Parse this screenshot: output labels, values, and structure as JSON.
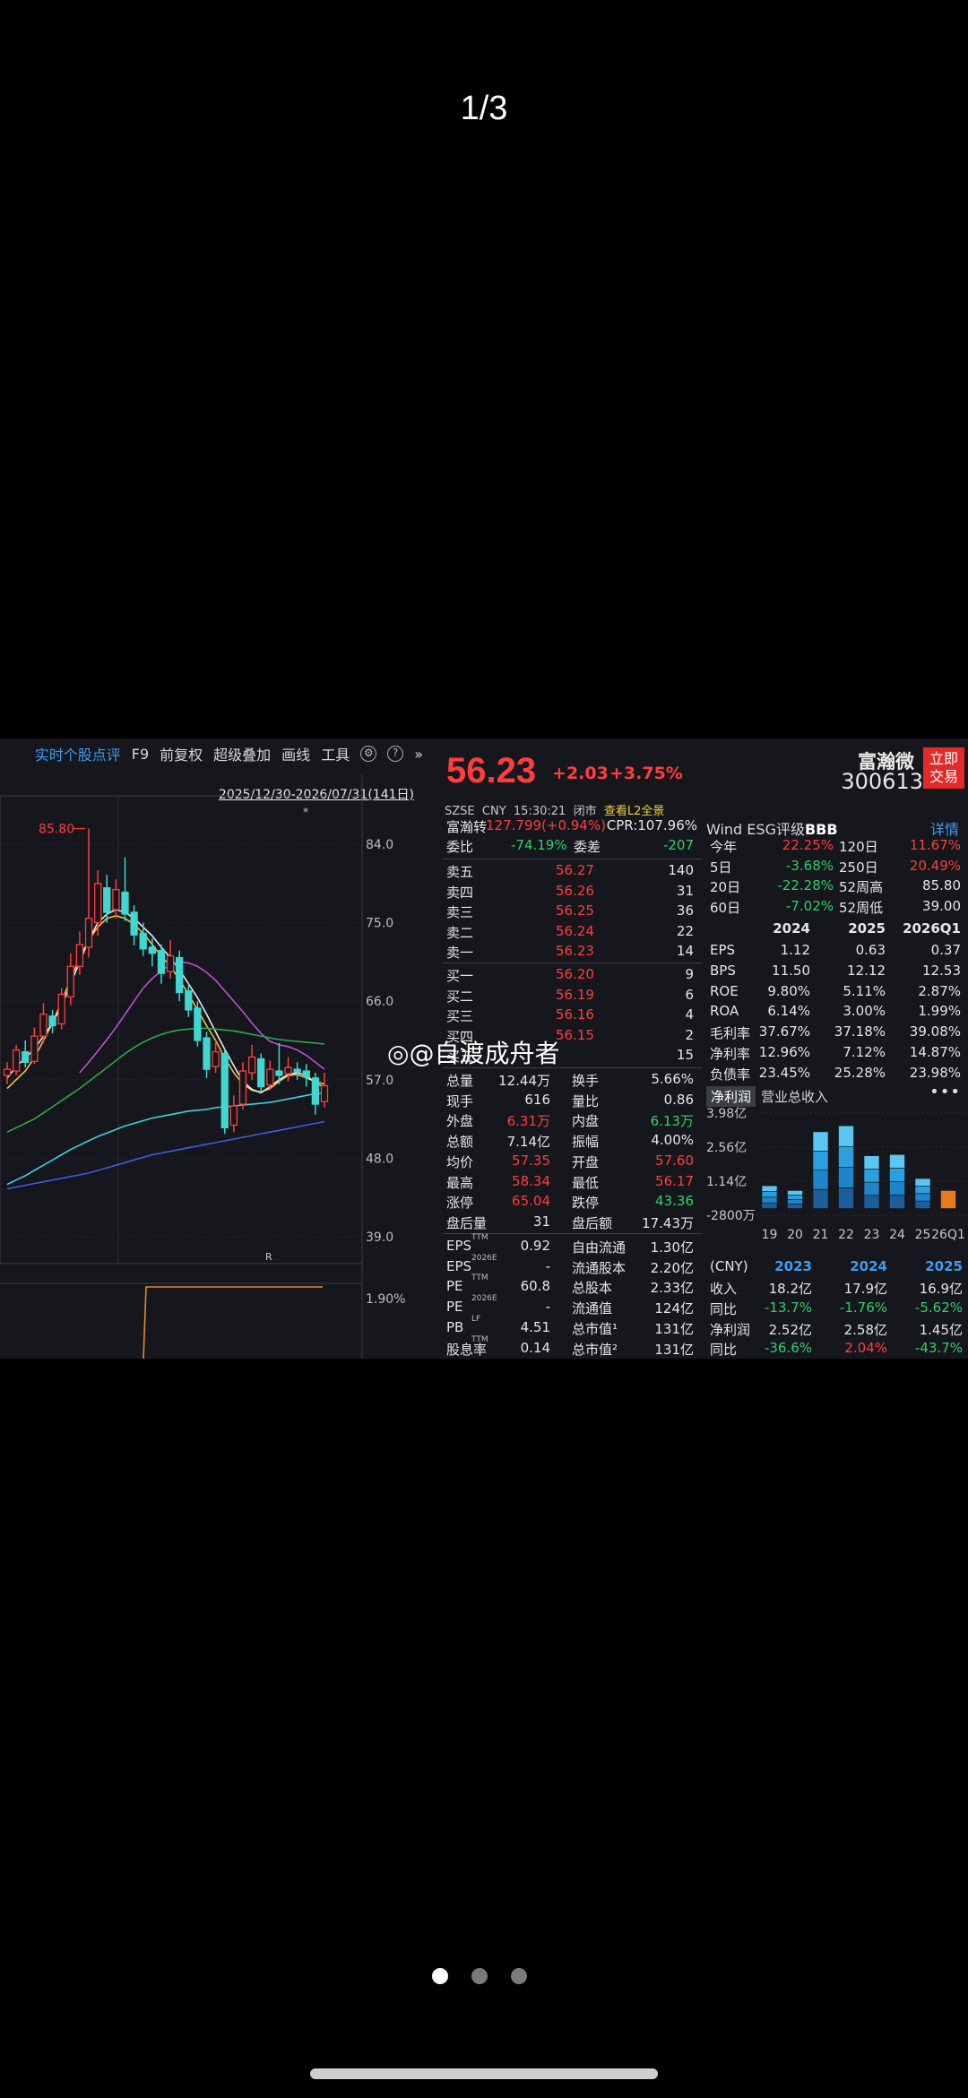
{
  "viewer": {
    "counter": "1/3",
    "watermark": "@自渡成舟者",
    "page_count": 3,
    "active_page": 0
  },
  "toolbar": {
    "comment": "实时个股点评",
    "f9": "F9",
    "adjust": "前复权",
    "overlay": "超级叠加",
    "draw": "画线",
    "tools": "工具"
  },
  "chart": {
    "range": "2025/12/30-2026/07/31(141日)",
    "high_label": "85.80",
    "y_ticks": [
      "84.0",
      "75.0",
      "66.0",
      "57.0",
      "48.0",
      "39.0"
    ],
    "sub_tick": "1.90%"
  },
  "quote": {
    "price": "56.23",
    "change": "+2.03",
    "change_pct": "+3.75%",
    "exchange": "SZSE",
    "currency": "CNY",
    "time": "15:30:21",
    "status": "闭市",
    "l2": "查看L2全景",
    "conv_label": "富瀚转",
    "conv_value": "127.799(+0.94%)",
    "cpr": "CPR:107.96%",
    "ratio_label": "委比",
    "ratio_value": "-74.19%",
    "diff_label": "委差",
    "diff_value": "-207",
    "asks": [
      {
        "label": "卖五",
        "price": "56.27",
        "vol": "140"
      },
      {
        "label": "卖四",
        "price": "56.26",
        "vol": "31"
      },
      {
        "label": "卖三",
        "price": "56.25",
        "vol": "36"
      },
      {
        "label": "卖二",
        "price": "56.24",
        "vol": "22"
      },
      {
        "label": "卖一",
        "price": "56.23",
        "vol": "14"
      }
    ],
    "bids": [
      {
        "label": "买一",
        "price": "56.20",
        "vol": "9"
      },
      {
        "label": "买二",
        "price": "56.19",
        "vol": "6"
      },
      {
        "label": "买三",
        "price": "56.16",
        "vol": "4"
      },
      {
        "label": "买四",
        "price": "56.15",
        "vol": "2"
      },
      {
        "label": "买五",
        "price": "",
        "vol": "15"
      }
    ],
    "stats": [
      {
        "l1": "总量",
        "v1": "12.44万",
        "c1": "white",
        "l2": "换手",
        "v2": "5.66%",
        "c2": "white"
      },
      {
        "l1": "现手",
        "v1": "616",
        "c1": "white",
        "l2": "量比",
        "v2": "0.86",
        "c2": "white"
      },
      {
        "l1": "外盘",
        "v1": "6.31万",
        "c1": "red",
        "l2": "内盘",
        "v2": "6.13万",
        "c2": "green"
      },
      {
        "l1": "总额",
        "v1": "7.14亿",
        "c1": "white",
        "l2": "振幅",
        "v2": "4.00%",
        "c2": "white"
      },
      {
        "l1": "均价",
        "v1": "57.35",
        "c1": "red",
        "l2": "开盘",
        "v2": "57.60",
        "c2": "red"
      },
      {
        "l1": "最高",
        "v1": "58.34",
        "c1": "red",
        "l2": "最低",
        "v2": "56.17",
        "c2": "red"
      },
      {
        "l1": "涨停",
        "v1": "65.04",
        "c1": "red",
        "l2": "跌停",
        "v2": "43.36",
        "c2": "green"
      },
      {
        "l1": "盘后量",
        "v1": "31",
        "c1": "white",
        "l2": "盘后额",
        "v2": "17.43万",
        "c2": "white"
      }
    ],
    "fund": [
      {
        "l1": "EPS",
        "s1": "TTM",
        "v1": "0.92",
        "l2": "自由流通",
        "v2": "1.30亿"
      },
      {
        "l1": "EPS",
        "s1": "2026E",
        "v1": "-",
        "l2": "流通股本",
        "v2": "2.20亿"
      },
      {
        "l1": "PE",
        "s1": "TTM",
        "v1": "60.8",
        "l2": "总股本",
        "v2": "2.33亿"
      },
      {
        "l1": "PE",
        "s1": "2026E",
        "v1": "-",
        "l2": "流通值",
        "v2": "124亿"
      },
      {
        "l1": "PB",
        "s1": "LF",
        "v1": "4.51",
        "l2": "总市值¹",
        "v2": "131亿"
      },
      {
        "l1": "股息率",
        "s1": "TTM",
        "v1": "0.14",
        "l2": "总市值²",
        "v2": "131亿"
      }
    ]
  },
  "fundamentals": {
    "name": "富瀚微",
    "code": "300613",
    "trade_btn_1": "立即",
    "trade_btn_2": "交易",
    "esg_label": "Wind ESG评级",
    "esg_value": "BBB",
    "detail": "详情",
    "periods": [
      {
        "l1": "今年",
        "v1": "22.25%",
        "c1": "red",
        "l2": "120日",
        "v2": "11.67%",
        "c2": "red"
      },
      {
        "l1": "5日",
        "v1": "-3.68%",
        "c1": "green",
        "l2": "250日",
        "v2": "20.49%",
        "c2": "red"
      },
      {
        "l1": "20日",
        "v1": "-22.28%",
        "c1": "green",
        "l2": "52周高",
        "v2": "85.80",
        "c2": "white"
      },
      {
        "l1": "60日",
        "v1": "-7.02%",
        "c1": "green",
        "l2": "52周低",
        "v2": "39.00",
        "c2": "white"
      }
    ],
    "years": [
      "2024",
      "2025",
      "2026Q1"
    ],
    "ratios": [
      {
        "label": "EPS",
        "values": [
          "1.12",
          "0.63",
          "0.37"
        ]
      },
      {
        "label": "BPS",
        "values": [
          "11.50",
          "12.12",
          "12.53"
        ]
      },
      {
        "label": "ROE",
        "values": [
          "9.80%",
          "5.11%",
          "2.87%"
        ]
      },
      {
        "label": "ROA",
        "values": [
          "6.14%",
          "3.00%",
          "1.99%"
        ]
      },
      {
        "label": "毛利率",
        "values": [
          "37.67%",
          "37.18%",
          "39.08%"
        ]
      },
      {
        "label": "净利率",
        "values": [
          "12.96%",
          "7.12%",
          "14.87%"
        ]
      },
      {
        "label": "负债率",
        "values": [
          "23.45%",
          "25.28%",
          "23.98%"
        ]
      }
    ],
    "tab_active": "净利润",
    "tab_other": "营业总收入",
    "more": "•••",
    "annual": {
      "cny": "(CNY)",
      "years": [
        "2023",
        "2024",
        "2025"
      ],
      "rows": [
        {
          "label": "收入",
          "values": [
            "18.2亿",
            "17.9亿",
            "16.9亿"
          ],
          "colors": [
            "white",
            "white",
            "white"
          ]
        },
        {
          "label": "同比",
          "values": [
            "-13.7%",
            "-1.76%",
            "-5.62%"
          ],
          "colors": [
            "green",
            "green",
            "green"
          ]
        },
        {
          "label": "净利润",
          "values": [
            "2.52亿",
            "2.58亿",
            "1.45亿"
          ],
          "colors": [
            "white",
            "white",
            "white"
          ]
        },
        {
          "label": "同比",
          "values": [
            "-36.6%",
            "2.04%",
            "-43.7%"
          ],
          "colors": [
            "green",
            "red",
            "green"
          ]
        }
      ]
    }
  },
  "chart_data": [
    {
      "type": "candlestick",
      "title": "",
      "xlabel": "",
      "ylabel": "",
      "ylim": [
        39.0,
        84.0
      ],
      "y_ticks": [
        84.0,
        75.0,
        66.0,
        57.0,
        48.0,
        39.0
      ],
      "annotation_high": 85.8,
      "candles": [
        {
          "o": 57.5,
          "c": 58.2,
          "h": 59.0,
          "l": 56.5
        },
        {
          "o": 58.0,
          "c": 60.4,
          "h": 61.0,
          "l": 57.5
        },
        {
          "o": 60.2,
          "c": 59.0,
          "h": 61.5,
          "l": 58.4
        },
        {
          "o": 59.1,
          "c": 62.0,
          "h": 63.0,
          "l": 58.8
        },
        {
          "o": 62.0,
          "c": 64.5,
          "h": 65.8,
          "l": 61.2
        },
        {
          "o": 64.3,
          "c": 63.2,
          "h": 65.0,
          "l": 62.3
        },
        {
          "o": 63.4,
          "c": 66.8,
          "h": 67.5,
          "l": 62.8
        },
        {
          "o": 66.5,
          "c": 70.0,
          "h": 71.5,
          "l": 65.5
        },
        {
          "o": 70.0,
          "c": 72.5,
          "h": 74.0,
          "l": 69.0
        },
        {
          "o": 72.2,
          "c": 75.5,
          "h": 85.8,
          "l": 71.0
        },
        {
          "o": 75.0,
          "c": 79.5,
          "h": 81.0,
          "l": 73.5
        },
        {
          "o": 79.0,
          "c": 76.2,
          "h": 80.5,
          "l": 75.0
        },
        {
          "o": 76.5,
          "c": 78.8,
          "h": 80.0,
          "l": 75.5
        },
        {
          "o": 78.5,
          "c": 76.0,
          "h": 82.5,
          "l": 75.2
        },
        {
          "o": 76.2,
          "c": 73.6,
          "h": 77.0,
          "l": 72.4
        },
        {
          "o": 73.8,
          "c": 72.0,
          "h": 75.0,
          "l": 71.2
        },
        {
          "o": 72.2,
          "c": 71.5,
          "h": 73.2,
          "l": 70.0
        },
        {
          "o": 71.8,
          "c": 69.2,
          "h": 72.5,
          "l": 68.0
        },
        {
          "o": 69.4,
          "c": 71.2,
          "h": 73.0,
          "l": 68.6
        },
        {
          "o": 71.0,
          "c": 67.0,
          "h": 71.8,
          "l": 66.0
        },
        {
          "o": 67.2,
          "c": 65.0,
          "h": 68.0,
          "l": 64.2
        },
        {
          "o": 65.2,
          "c": 61.5,
          "h": 66.0,
          "l": 60.8
        },
        {
          "o": 61.8,
          "c": 58.2,
          "h": 62.5,
          "l": 57.2
        },
        {
          "o": 58.5,
          "c": 60.2,
          "h": 61.5,
          "l": 57.8
        },
        {
          "o": 60.0,
          "c": 51.5,
          "h": 60.5,
          "l": 50.8
        },
        {
          "o": 51.8,
          "c": 54.0,
          "h": 55.2,
          "l": 51.0
        },
        {
          "o": 54.2,
          "c": 58.0,
          "h": 59.0,
          "l": 53.6
        },
        {
          "o": 57.8,
          "c": 59.6,
          "h": 61.0,
          "l": 57.0
        },
        {
          "o": 59.4,
          "c": 56.2,
          "h": 60.0,
          "l": 55.5
        },
        {
          "o": 56.4,
          "c": 58.2,
          "h": 59.2,
          "l": 55.8
        },
        {
          "o": 58.0,
          "c": 57.5,
          "h": 61.2,
          "l": 56.5
        },
        {
          "o": 57.7,
          "c": 58.4,
          "h": 59.6,
          "l": 56.8
        },
        {
          "o": 58.2,
          "c": 57.9,
          "h": 59.0,
          "l": 57.0
        },
        {
          "o": 58.0,
          "c": 57.3,
          "h": 58.8,
          "l": 56.2
        },
        {
          "o": 57.2,
          "c": 54.2,
          "h": 57.8,
          "l": 53.0
        },
        {
          "o": 54.5,
          "c": 56.3,
          "h": 57.8,
          "l": 53.8
        }
      ],
      "moving_averages": [
        {
          "color": "#f0c040",
          "values": [
            56.0,
            57.0,
            58.0,
            59.5,
            61.5,
            63.5,
            66.0,
            68.5,
            71.0,
            73.0,
            74.5,
            75.5,
            75.8,
            75.5,
            74.8,
            73.8,
            72.5,
            71.2,
            70.0,
            68.5,
            66.8,
            65.0,
            63.2,
            61.5,
            59.5,
            57.8,
            56.5,
            55.8,
            55.6,
            56.0,
            56.8,
            57.5,
            57.6,
            57.2,
            56.8,
            56.5
          ]
        },
        {
          "color": "#e8e8e8",
          "values": [
            57.2,
            58.5,
            59.5,
            60.5,
            62.0,
            63.5,
            65.5,
            68.0,
            70.5,
            73.0,
            75.0,
            76.0,
            76.5,
            76.2,
            75.5,
            74.5,
            73.5,
            72.2,
            71.0,
            69.6,
            68.0,
            66.4,
            64.5,
            62.5,
            60.5,
            58.6,
            56.8,
            55.9,
            55.5,
            56.2,
            57.0,
            57.6,
            57.8,
            57.5,
            56.6,
            56.2
          ]
        },
        {
          "color": "#c050d0",
          "values": [
            null,
            null,
            null,
            null,
            null,
            null,
            null,
            null,
            57.8,
            59.0,
            60.3,
            61.6,
            63.0,
            64.5,
            66.0,
            67.5,
            68.6,
            69.5,
            70.2,
            70.5,
            70.4,
            70.0,
            69.3,
            68.4,
            67.2,
            66.0,
            64.8,
            63.5,
            62.3,
            61.4,
            61.0,
            60.8,
            60.4,
            59.8,
            59.0,
            58.2
          ]
        },
        {
          "color": "#2ea84a",
          "values": [
            51.0,
            51.5,
            52.0,
            52.5,
            53.2,
            53.9,
            54.6,
            55.3,
            56.0,
            56.8,
            57.6,
            58.4,
            59.2,
            60.0,
            60.7,
            61.3,
            61.8,
            62.2,
            62.5,
            62.7,
            62.8,
            62.9,
            62.9,
            62.8,
            62.7,
            62.6,
            62.4,
            62.2,
            62.0,
            61.8,
            61.6,
            61.5,
            61.4,
            61.3,
            61.2,
            61.1
          ]
        },
        {
          "color": "#3fd0e0",
          "values": [
            45.0,
            45.5,
            46.0,
            46.6,
            47.2,
            47.8,
            48.4,
            49.0,
            49.5,
            50.0,
            50.5,
            50.9,
            51.3,
            51.7,
            52.0,
            52.3,
            52.6,
            52.8,
            53.0,
            53.2,
            53.4,
            53.5,
            53.6,
            53.8,
            53.9,
            54.0,
            54.1,
            54.2,
            54.3,
            54.4,
            54.6,
            54.8,
            55.0,
            55.2,
            55.4,
            55.5
          ]
        },
        {
          "color": "#3860e0",
          "values": [
            44.5,
            44.7,
            44.9,
            45.1,
            45.3,
            45.5,
            45.7,
            45.9,
            46.1,
            46.3,
            46.6,
            46.9,
            47.2,
            47.5,
            47.8,
            48.1,
            48.4,
            48.6,
            48.8,
            49.0,
            49.2,
            49.4,
            49.6,
            49.8,
            50.0,
            50.2,
            50.4,
            50.6,
            50.8,
            51.0,
            51.2,
            51.4,
            51.6,
            51.8,
            52.0,
            52.2
          ]
        }
      ]
    },
    {
      "type": "bar",
      "title": "",
      "xlabel": "",
      "ylabel": "",
      "categories": [
        "19",
        "20",
        "21",
        "22",
        "23",
        "24",
        "25",
        "26Q1"
      ],
      "y_ticks": [
        "3.98亿",
        "2.56亿",
        "1.14亿",
        "-2800万"
      ],
      "ylim": [
        -0.28,
        3.98
      ],
      "values": [
        0.95,
        0.75,
        3.2,
        3.45,
        2.2,
        2.25,
        1.25,
        0.75
      ]
    }
  ]
}
